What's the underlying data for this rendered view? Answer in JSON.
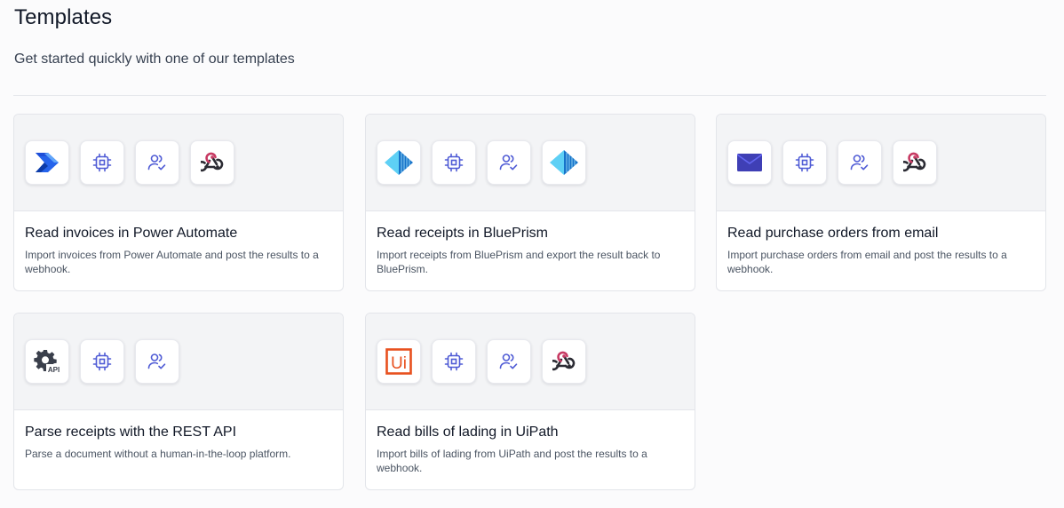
{
  "header": {
    "title": "Templates",
    "subtitle": "Get started quickly with one of our templates"
  },
  "templates": [
    {
      "title": "Read invoices in Power Automate",
      "description": "Import invoices from Power Automate and post the results to a webhook.",
      "icons": [
        "power-automate-icon",
        "processor-chip-icon",
        "users-check-icon",
        "webhook-icon"
      ]
    },
    {
      "title": "Read receipts in BluePrism",
      "description": "Import receipts from BluePrism and export the result back to BluePrism.",
      "icons": [
        "blueprism-icon",
        "processor-chip-icon",
        "users-check-icon",
        "blueprism-icon"
      ]
    },
    {
      "title": "Read purchase orders from email",
      "description": "Import purchase orders from email and post the results to a webhook.",
      "icons": [
        "email-envelope-icon",
        "processor-chip-icon",
        "users-check-icon",
        "webhook-icon"
      ]
    },
    {
      "title": "Parse receipts with the REST API",
      "description": "Parse a document without a human-in-the-loop platform.",
      "icons": [
        "api-gear-icon",
        "processor-chip-icon",
        "users-check-icon"
      ],
      "api_icon_label": "API"
    },
    {
      "title": "Read bills of lading in UiPath",
      "description": "Import bills of lading from UiPath and post the results to a webhook.",
      "icons": [
        "uipath-icon",
        "processor-chip-icon",
        "users-check-icon",
        "webhook-icon"
      ],
      "uipath_icon_label": "Ui"
    }
  ],
  "colors": {
    "accent_blue": "#4f5bd5",
    "power_automate_blue": "#2563eb",
    "blueprism_cyan": "#38bdf8",
    "uipath_orange": "#e8501e",
    "webhook_pink": "#c73a63",
    "email_indigo": "#4338ca"
  }
}
